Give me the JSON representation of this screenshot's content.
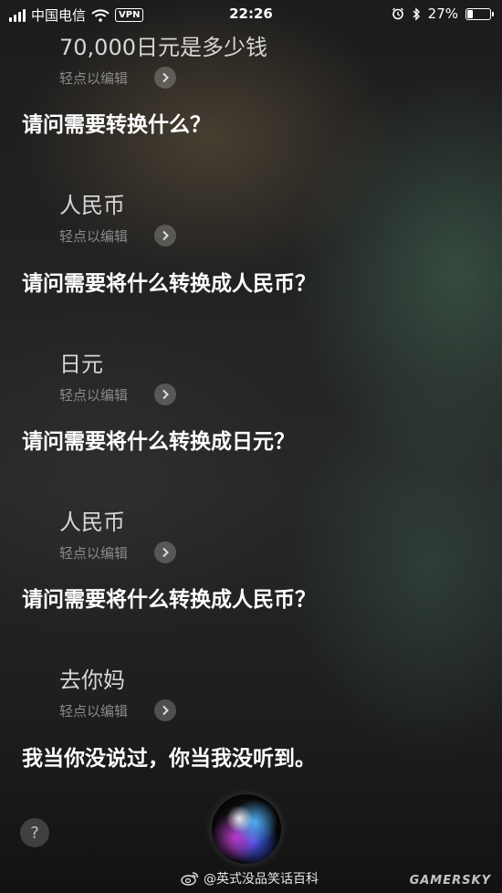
{
  "status_bar": {
    "carrier": "中国电信",
    "vpn": "VPN",
    "time": "22:26",
    "battery_percent": "27%",
    "battery_level": 0.27
  },
  "conversation": [
    {
      "utterance": "70,000日元是多少钱",
      "tap_to_edit": "轻点以编辑",
      "reply": "请问需要转换什么？"
    },
    {
      "utterance": "人民币",
      "tap_to_edit": "轻点以编辑",
      "reply": "请问需要将什么转换成人民币？"
    },
    {
      "utterance": "日元",
      "tap_to_edit": "轻点以编辑",
      "reply": "请问需要将什么转换成日元？"
    },
    {
      "utterance": "人民币",
      "tap_to_edit": "轻点以编辑",
      "reply": "请问需要将什么转换成人民币？"
    },
    {
      "utterance": "去你妈",
      "tap_to_edit": "轻点以编辑",
      "reply": "我当你没说过，你当我没听到。"
    }
  ],
  "bottom": {
    "help": "?",
    "watermark": "@英式没品笑话百科",
    "site_watermark": "GAMERSKY"
  },
  "icons": {
    "signal": "signal-bars-icon",
    "wifi": "wifi-icon",
    "alarm": "alarm-clock-icon",
    "bluetooth": "bluetooth-icon",
    "battery": "battery-icon",
    "chevron": "chevron-right-icon",
    "siri": "siri-orb-icon",
    "weibo": "weibo-icon"
  }
}
